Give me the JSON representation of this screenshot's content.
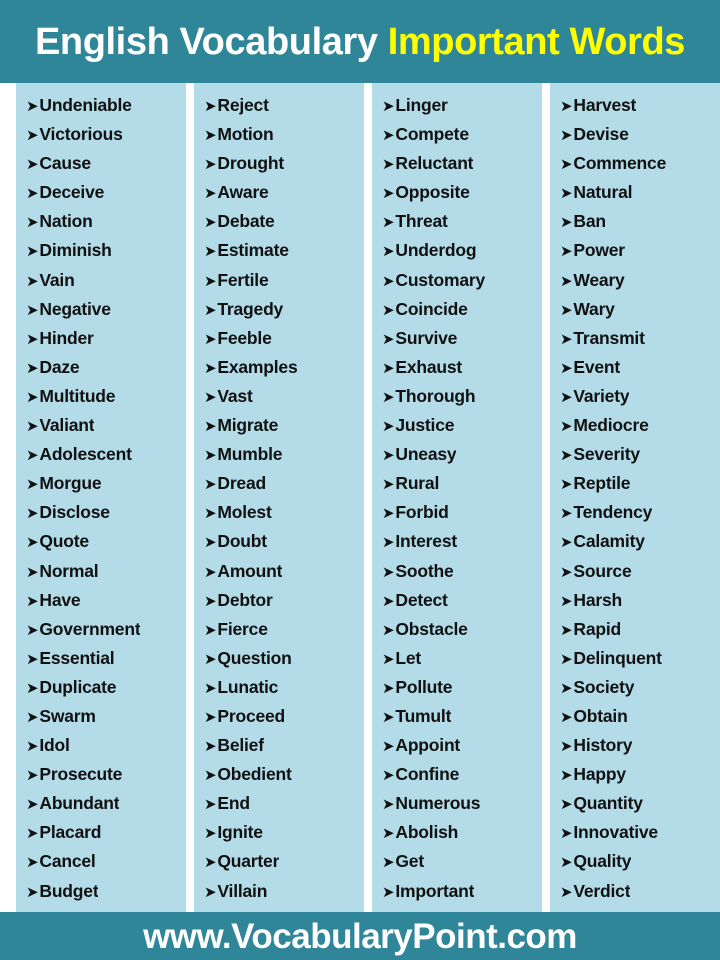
{
  "header": {
    "title_main": "English Vocabulary ",
    "title_accent": "Important Words",
    "background_color": "#2f8699",
    "main_color": "#ffffff",
    "accent_color": "#ffff00"
  },
  "bullet": {
    "glyph": "➤",
    "name": "arrow-bullet-icon"
  },
  "columns": [
    {
      "index": 1,
      "background_color": "#b3dce8",
      "words": [
        "Undeniable",
        "Victorious",
        "Cause",
        "Deceive",
        "Nation",
        "Diminish",
        "Vain",
        "Negative",
        "Hinder",
        "Daze",
        "Multitude",
        "Valiant",
        "Adolescent",
        "Morgue",
        "Disclose",
        "Quote",
        "Normal",
        "Have",
        "Government",
        "Essential",
        "Duplicate",
        "Swarm",
        "Idol",
        "Prosecute",
        "Abundant",
        "Placard",
        "Cancel",
        "Budget"
      ]
    },
    {
      "index": 2,
      "background_color": "#b3dce8",
      "words": [
        "Reject",
        "Motion",
        "Drought",
        "Aware",
        "Debate",
        "Estimate",
        "Fertile",
        "Tragedy",
        "Feeble",
        "Examples",
        "Vast",
        "Migrate",
        "Mumble",
        "Dread",
        "Molest",
        "Doubt",
        "Amount",
        "Debtor",
        "Fierce",
        "Question",
        "Lunatic",
        "Proceed",
        "Belief",
        "Obedient",
        "End",
        "Ignite",
        "Quarter",
        "Villain"
      ]
    },
    {
      "index": 3,
      "background_color": "#b3dce8",
      "words": [
        "Linger",
        "Compete",
        "Reluctant",
        "Opposite",
        "Threat",
        "Underdog",
        "Customary",
        "Coincide",
        "Survive",
        "Exhaust",
        "Thorough",
        "Justice",
        "Uneasy",
        "Rural",
        "Forbid",
        "Interest",
        "Soothe",
        "Detect",
        "Obstacle",
        "Let",
        "Pollute",
        "Tumult",
        "Appoint",
        "Confine",
        "Numerous",
        "Abolish",
        "Get",
        "Important"
      ]
    },
    {
      "index": 4,
      "background_color": "#b3dce8",
      "words": [
        "Harvest",
        "Devise",
        "Commence",
        "Natural",
        "Ban",
        "Power",
        "Weary",
        "Wary",
        "Transmit",
        "Event",
        "Variety",
        "Mediocre",
        "Severity",
        "Reptile",
        "Tendency",
        "Calamity",
        "Source",
        "Harsh",
        "Rapid",
        "Delinquent",
        "Society",
        "Obtain",
        "History",
        "Happy",
        "Quantity",
        "Innovative",
        "Quality",
        "Verdict"
      ]
    }
  ],
  "footer": {
    "url": "www.VocabularyPoint.com",
    "background_color": "#2f8699",
    "text_color": "#ffffff"
  }
}
